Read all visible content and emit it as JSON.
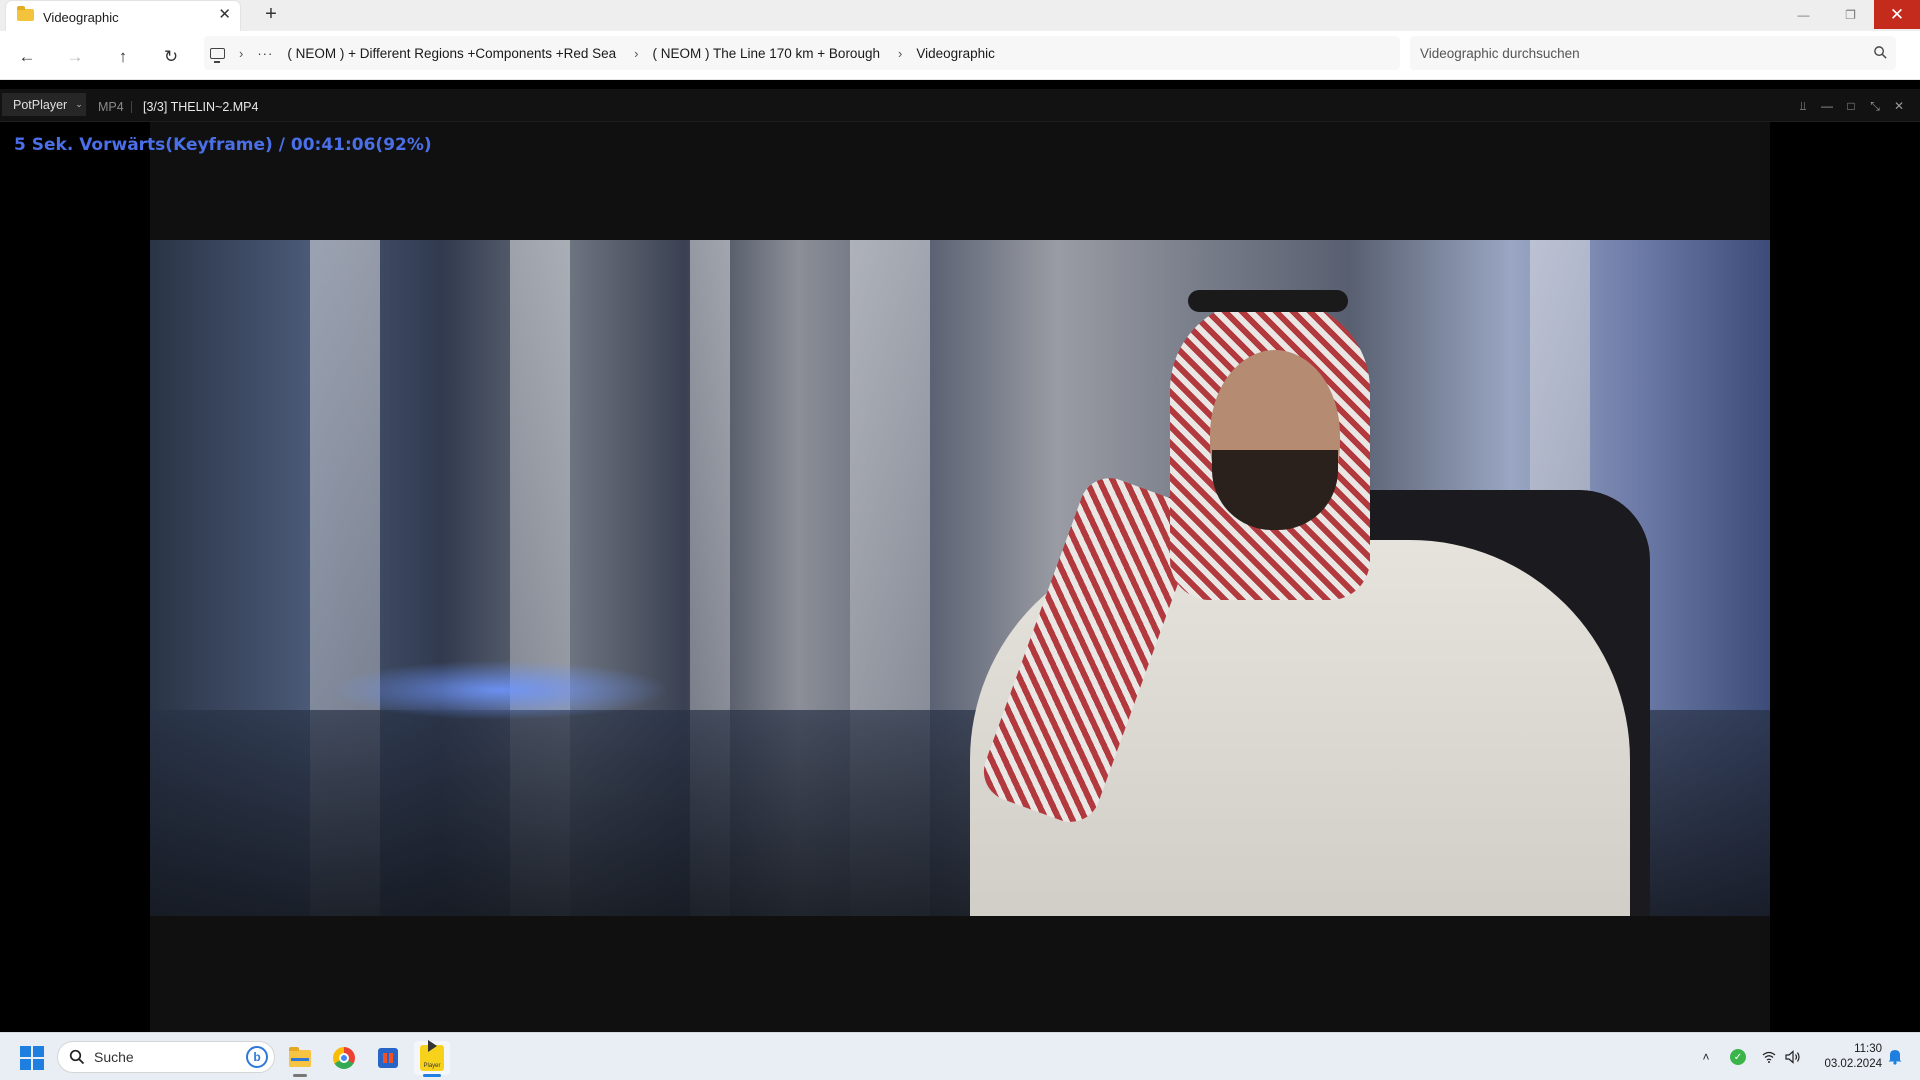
{
  "explorer": {
    "tab_title": "Videographic",
    "tab_close": "✕",
    "new_tab": "+",
    "window_controls": {
      "minimize": "—",
      "maximize": "❐",
      "close": "✕"
    },
    "nav": {
      "back": "←",
      "forward": "→",
      "up": "↑",
      "refresh": "↻"
    },
    "breadcrumb": {
      "overflow": "···",
      "separator": "›",
      "segments": [
        "( NEOM ) + Different Regions +Components +Red Sea",
        "( NEOM ) The Line 170 km + Borough",
        "Videographic"
      ]
    },
    "search_placeholder": "Videographic durchsuchen"
  },
  "player": {
    "menu_label": "PotPlayer",
    "menu_chevron": "⌄",
    "format": "MP4",
    "file": "[3/3] THELIN~2.MP4",
    "controls": {
      "pin": "⫫",
      "minimize": "—",
      "maximize": "□",
      "fullscreen": "⤡",
      "close": "✕"
    },
    "osd_message": "5  Sek. Vorwärts(Keyframe) / 00:41:06(92%)",
    "progress_fraction": 0.92
  },
  "taskbar": {
    "search_placeholder": "Suche",
    "bing_label": "b",
    "apps": [
      "file-explorer",
      "chrome",
      "microsoft-store",
      "potplayer"
    ],
    "potplayer_label": "Player",
    "tray": {
      "chevron": "˄",
      "shield": "✓",
      "wifi": "◔",
      "volume": "◁"
    },
    "time": "11:30",
    "date": "03.02.2024"
  },
  "colors": {
    "osd_text": "#4a6fe8",
    "close_button": "#c42b1c",
    "windows_blue": "#1f7fe0",
    "potplayer_yellow": "#f7d21a"
  }
}
